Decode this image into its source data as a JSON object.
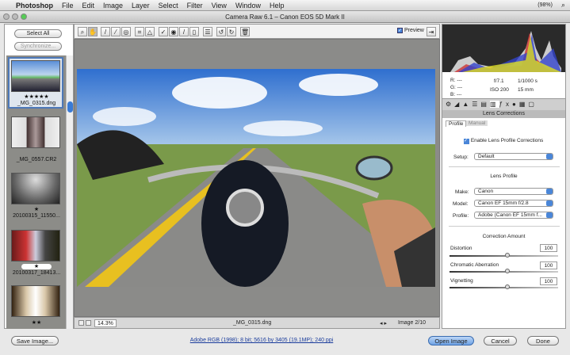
{
  "menubar": {
    "app": "Photoshop",
    "items": [
      "File",
      "Edit",
      "Image",
      "Layer",
      "Select",
      "Filter",
      "View",
      "Window",
      "Help"
    ],
    "status": "(98%)"
  },
  "window": {
    "title": "Camera Raw 6.1  –  Canon EOS 5D Mark II"
  },
  "filmstrip": {
    "select_all": "Select All",
    "synchronize": "Synchronize...",
    "items": [
      {
        "name": "_MG_0315.dng",
        "rating": "★★★★★"
      },
      {
        "name": "_MG_0557.CR2",
        "rating": ""
      },
      {
        "name": "20100315_11550...",
        "rating": "★"
      },
      {
        "name": "20100317_18413...",
        "rating": "★"
      },
      {
        "name": "",
        "rating": "★★"
      }
    ]
  },
  "toolbar": {
    "preview_label": "Preview"
  },
  "bottombar": {
    "zoom": "14.3%",
    "filename": "_MG_0315.dng",
    "image_count": "Image 2/10"
  },
  "info": {
    "r": "R:",
    "g": "G:",
    "b": "B:",
    "dash": "---",
    "aperture": "f/7.1",
    "shutter": "1/1000 s",
    "iso": "ISO 200",
    "focal": "15 mm"
  },
  "panel": {
    "title": "Lens Corrections",
    "tabs": [
      "Profile",
      "Manual"
    ],
    "enable_label": "Enable Lens Profile Corrections",
    "setup_label": "Setup:",
    "setup_value": "Default",
    "lens_profile_heading": "Lens Profile",
    "make_label": "Make:",
    "make_value": "Canon",
    "model_label": "Model:",
    "model_value": "Canon EF 15mm f/2.8",
    "profile_label": "Profile:",
    "profile_value": "Adobe (Canon EF 15mm f...",
    "correction_heading": "Correction Amount",
    "sliders": [
      {
        "label": "Distortion",
        "value": "100"
      },
      {
        "label": "Chromatic Aberration",
        "value": "100"
      },
      {
        "label": "Vignetting",
        "value": "100"
      }
    ]
  },
  "footer": {
    "save": "Save Image...",
    "workflow": "Adobe RGB (1998); 8 bit; 5616 by 3405 (19.1MP); 240 ppi",
    "open": "Open Image",
    "cancel": "Cancel",
    "done": "Done"
  }
}
